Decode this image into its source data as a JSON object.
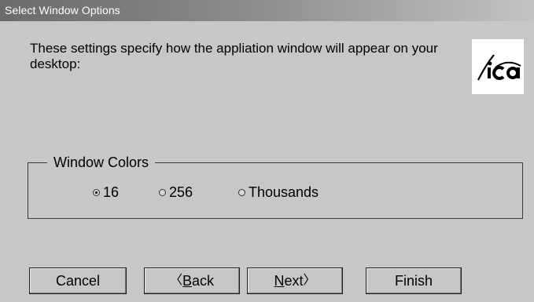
{
  "window": {
    "title": "Select Window Options"
  },
  "description": "These settings specify how the appliation window will appear on your desktop:",
  "logo": {
    "text": "ica",
    "icon": "ica-logo"
  },
  "colors_group": {
    "legend": "Window Colors",
    "options": [
      {
        "label": "16",
        "selected": true
      },
      {
        "label": "256",
        "selected": false
      },
      {
        "label": "Thousands",
        "selected": false
      }
    ]
  },
  "buttons": {
    "cancel": "Cancel",
    "back_prefix": "〈 ",
    "back_mnemonic": "B",
    "back_rest": "ack",
    "next_mnemonic": "N",
    "next_rest": "ext",
    "next_suffix": "〉",
    "finish": "Finish"
  }
}
